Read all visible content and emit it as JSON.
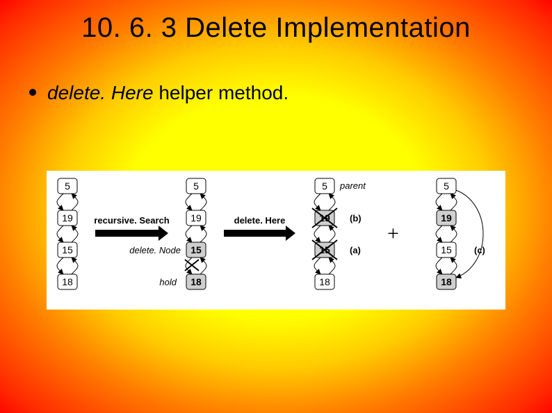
{
  "title": "10. 6. 3 Delete Implementation",
  "bullet": {
    "em": "delete. Here",
    "rest": " helper method."
  },
  "diagram": {
    "trees": [
      {
        "nodes": [
          {
            "v": "5"
          },
          {
            "v": "19"
          },
          {
            "v": "15"
          },
          {
            "v": "18"
          }
        ]
      },
      {
        "nodes": [
          {
            "v": "5"
          },
          {
            "v": "19"
          },
          {
            "v": "15",
            "bold": true,
            "label_left": "delete. Node"
          },
          {
            "v": "18",
            "bold": true,
            "hold": true
          }
        ]
      },
      {
        "nodes": [
          {
            "v": "5",
            "label_right": "parent"
          },
          {
            "v": "19",
            "bold": true,
            "strike": true,
            "ann": "(b)"
          },
          {
            "v": "15",
            "bold": true,
            "strike": true,
            "ann": "(a)"
          },
          {
            "v": "18"
          }
        ]
      },
      {
        "nodes": [
          {
            "v": "5"
          },
          {
            "v": "19",
            "bold": true
          },
          {
            "v": "15",
            "ann": "(c)"
          },
          {
            "v": "18",
            "bold": true
          }
        ]
      }
    ],
    "arrows": [
      {
        "label": "recursive. Search",
        "bold": true
      },
      {
        "label": "delete. Here",
        "bold": true
      }
    ],
    "plus": "+"
  }
}
